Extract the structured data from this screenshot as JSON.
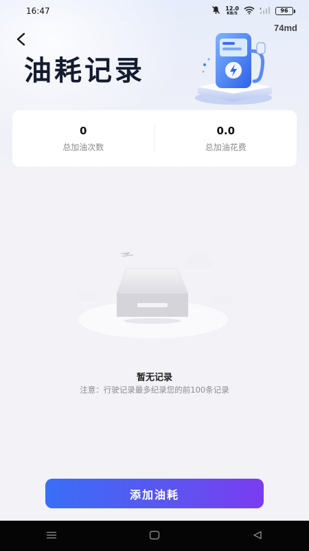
{
  "status_bar": {
    "time": "16:47",
    "net_speed_value": "12.0",
    "net_speed_unit": "KB/S",
    "battery": "96"
  },
  "header": {
    "title": "油耗记录",
    "version_tag": "74md",
    "back_icon": "chevron-left-icon"
  },
  "stats": {
    "refuel_count_value": "0",
    "refuel_count_label": "总加油次数",
    "refuel_cost_value": "0.0",
    "refuel_cost_label": "总加油花费"
  },
  "empty_state": {
    "title": "暂无记录",
    "note": "注意：行驶记录最多纪录您的前100条记录"
  },
  "actions": {
    "add_label": "添加油耗"
  },
  "colors": {
    "accent_start": "#3a6ef6",
    "accent_end": "#7b3cf0",
    "page_bg": "#f2f2f7"
  },
  "nav": {
    "menu_icon": "menu-icon",
    "home_icon": "home-square-icon",
    "back_icon": "back-triangle-icon"
  }
}
